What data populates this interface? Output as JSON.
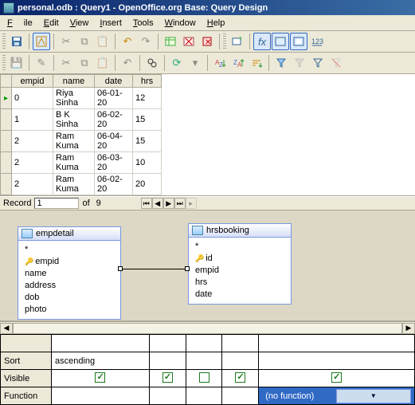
{
  "window": {
    "title": "personal.odb : Query1 - OpenOffice.org Base: Query Design"
  },
  "menu": {
    "file": "File",
    "edit": "Edit",
    "view": "View",
    "insert": "Insert",
    "tools": "Tools",
    "window": "Window",
    "help": "Help"
  },
  "data_headers": {
    "empid": "empid",
    "name": "name",
    "date": "date",
    "hrs": "hrs"
  },
  "data_rows": [
    {
      "empid": "0",
      "name": "Riya Sinha",
      "date": "06-01-20",
      "hrs": "12"
    },
    {
      "empid": "1",
      "name": "B K Sinha",
      "date": "06-02-20",
      "hrs": "15"
    },
    {
      "empid": "2",
      "name": "Ram Kuma",
      "date": "06-04-20",
      "hrs": "15"
    },
    {
      "empid": "2",
      "name": "Ram Kuma",
      "date": "06-03-20",
      "hrs": "10"
    },
    {
      "empid": "2",
      "name": "Ram Kuma",
      "date": "06-02-20",
      "hrs": "20"
    }
  ],
  "record": {
    "label": "Record",
    "current": "1",
    "of": "of",
    "total": "9"
  },
  "tables": {
    "empdetail": {
      "title": "empdetail",
      "fields": [
        "*",
        "empid",
        "name",
        "address",
        "dob",
        "photo"
      ],
      "key": "empid"
    },
    "hrsbooking": {
      "title": "hrsbooking",
      "fields": [
        "*",
        "id",
        "empid",
        "hrs",
        "date"
      ],
      "key": "id"
    }
  },
  "design": {
    "sort_label": "Sort",
    "sort_val": "ascending",
    "visible_label": "Visible",
    "visible": [
      true,
      true,
      false,
      true,
      true
    ],
    "function_label": "Function",
    "function_sel": "(no function)"
  }
}
